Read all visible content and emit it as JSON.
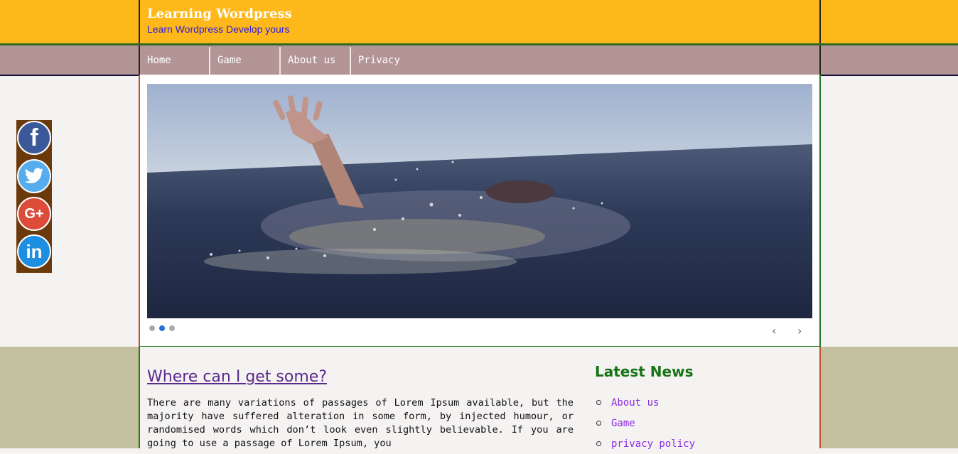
{
  "header": {
    "site_title": "Learning Wordpress",
    "tagline": "Learn Wordpress Develop yours"
  },
  "nav": {
    "items": [
      {
        "label": "Home"
      },
      {
        "label": "Game"
      },
      {
        "label": "About us"
      },
      {
        "label": "Privacy"
      }
    ]
  },
  "slider": {
    "slide_count": 3,
    "active_index": 1,
    "prev_icon": "chevron-left-icon",
    "next_icon": "chevron-right-icon"
  },
  "social": {
    "buttons": [
      {
        "icon": "facebook-icon",
        "color": "#3b5998"
      },
      {
        "icon": "twitter-icon",
        "color": "#55acee"
      },
      {
        "icon": "google-plus-icon",
        "color": "#dd4b39"
      },
      {
        "icon": "linkedin-icon",
        "color": "#1e8ee0"
      }
    ]
  },
  "post": {
    "title": "Where can I get some?",
    "body": "There are many variations of passages of Lorem Ipsum available, but the majority have suffered alteration in some form, by injected humour, or randomised words which don’t look even slightly believable. If you are going to use a passage of Lorem Ipsum, you"
  },
  "sidebar": {
    "widget_title": "Latest News",
    "items": [
      {
        "label": "About us"
      },
      {
        "label": "Game"
      },
      {
        "label": "privacy policy"
      }
    ]
  },
  "colors": {
    "header_bg": "#ffb819",
    "nav_bg": "#b49595",
    "content_band_bg": "#c2c09e",
    "title_link": "#5b2a8c",
    "widget_title": "#167316",
    "news_link": "#8a2be2"
  }
}
